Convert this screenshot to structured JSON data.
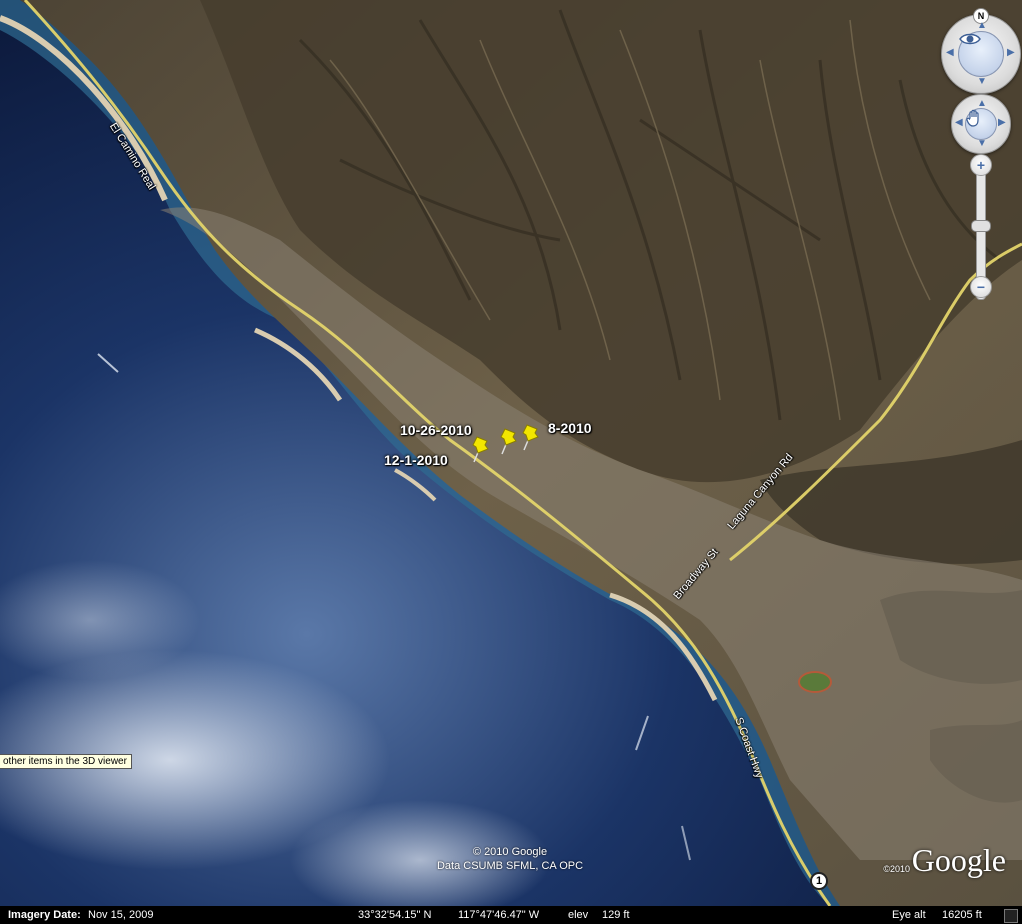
{
  "road_labels": {
    "el_camino_real": "El Camino Real",
    "laguna_canyon_rd": "Laguna Canyon Rd",
    "broadway_st": "Broadway St",
    "s_coast_hwy": "S Coast Hwy"
  },
  "pins": [
    {
      "label": "10-26-2010",
      "color": "#f2e600"
    },
    {
      "label": "8-2010",
      "color": "#f2e600"
    },
    {
      "label": "12-1-2010",
      "color": "#f2e600"
    }
  ],
  "route_shield": "1",
  "copyright": {
    "line1": "© 2010 Google",
    "line2": "Data CSUMB SFML, CA OPC"
  },
  "google_logo": {
    "year": "©2010",
    "text": "Google"
  },
  "tooltip": "other items in the 3D viewer",
  "nav": {
    "north": "N",
    "zoom_in": "+",
    "zoom_out": "−"
  },
  "status_bar": {
    "imagery_label": "Imagery Date:",
    "imagery_date": "Nov 15, 2009",
    "lat": "33°32'54.15\" N",
    "lon": "117°47'46.47\" W",
    "elev_label": "elev",
    "elev_value": "129 ft",
    "eye_label": "Eye alt",
    "eye_value": "16205 ft"
  },
  "colors": {
    "ocean_deep": "#0b1a3d",
    "ocean_shallow": "#2e6f9c",
    "land": "#6b5f48",
    "hills": "#4a4233",
    "road": "#e9dc6a",
    "pin": "#f2e600"
  }
}
